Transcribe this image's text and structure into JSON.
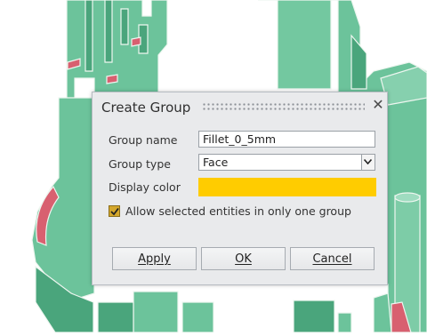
{
  "dialog": {
    "title": "Create Group",
    "close_glyph": "✕",
    "group_name_label": "Group name",
    "group_name_value": "Fillet_0_5mm",
    "group_type_label": "Group type",
    "group_type_value": "Face",
    "display_color_label": "Display color",
    "display_color": "#ffcc00",
    "checkbox_label": "Allow selected entities in only one group",
    "checkbox_checked": true,
    "buttons": {
      "apply": "Apply",
      "ok": "OK",
      "cancel": "Cancel"
    }
  },
  "colors": {
    "model_green": "#6cc39b",
    "model_edge": "#eef6f0",
    "highlight_red": "#d86070",
    "checkbox_accent": "#d4a72c"
  },
  "icons": {
    "close": "close-icon",
    "dropdown": "chevron-down-icon",
    "check": "checkmark-icon",
    "grip": "drag-grip-icon"
  }
}
